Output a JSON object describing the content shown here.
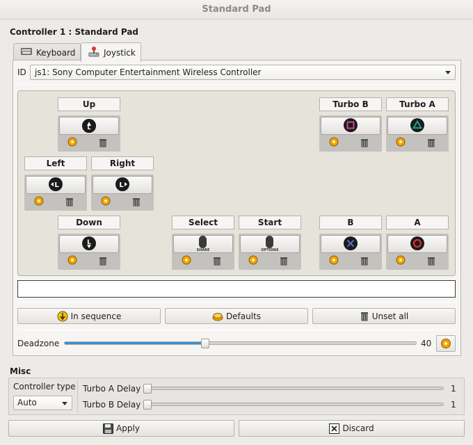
{
  "window": {
    "title": "Standard Pad"
  },
  "controller_group": {
    "title": "Controller 1 : Standard Pad"
  },
  "tabs": [
    {
      "label": "Keyboard",
      "icon": "keyboard-icon"
    },
    {
      "label": "Joystick",
      "icon": "joystick-icon"
    }
  ],
  "id_field": {
    "label": "ID",
    "value": "js1: Sony Computer Entertainment Wireless Controller"
  },
  "mappings": {
    "up": {
      "label": "Up",
      "glyph": "L"
    },
    "left": {
      "label": "Left",
      "glyph": "L"
    },
    "right": {
      "label": "Right",
      "glyph": "L"
    },
    "down": {
      "label": "Down",
      "glyph": "L"
    },
    "select": {
      "label": "Select",
      "caption": "SHARE"
    },
    "start": {
      "label": "Start",
      "caption": "OPTIONS"
    },
    "turbo_b": {
      "label": "Turbo B"
    },
    "turbo_a": {
      "label": "Turbo A"
    },
    "b": {
      "label": "B"
    },
    "a": {
      "label": "A"
    }
  },
  "actions": {
    "in_sequence": "In sequence",
    "defaults": "Defaults",
    "unset_all": "Unset all"
  },
  "deadzone": {
    "label": "Deadzone",
    "value": "40",
    "fraction": 0.4
  },
  "misc": {
    "title": "Misc",
    "controller_type_label": "Controller type",
    "controller_type_value": "Auto",
    "turbo_a_label": "Turbo A Delay",
    "turbo_a_value": "1",
    "turbo_b_label": "Turbo B Delay",
    "turbo_b_value": "1"
  },
  "footer": {
    "apply": "Apply",
    "discard": "Discard"
  },
  "colors": {
    "accent": "#3c8ed3",
    "triangle": "#1f9e8c",
    "square": "#d0448f",
    "circle": "#d72f3a",
    "cross": "#4f6fc9",
    "gear": "#f0a500"
  }
}
